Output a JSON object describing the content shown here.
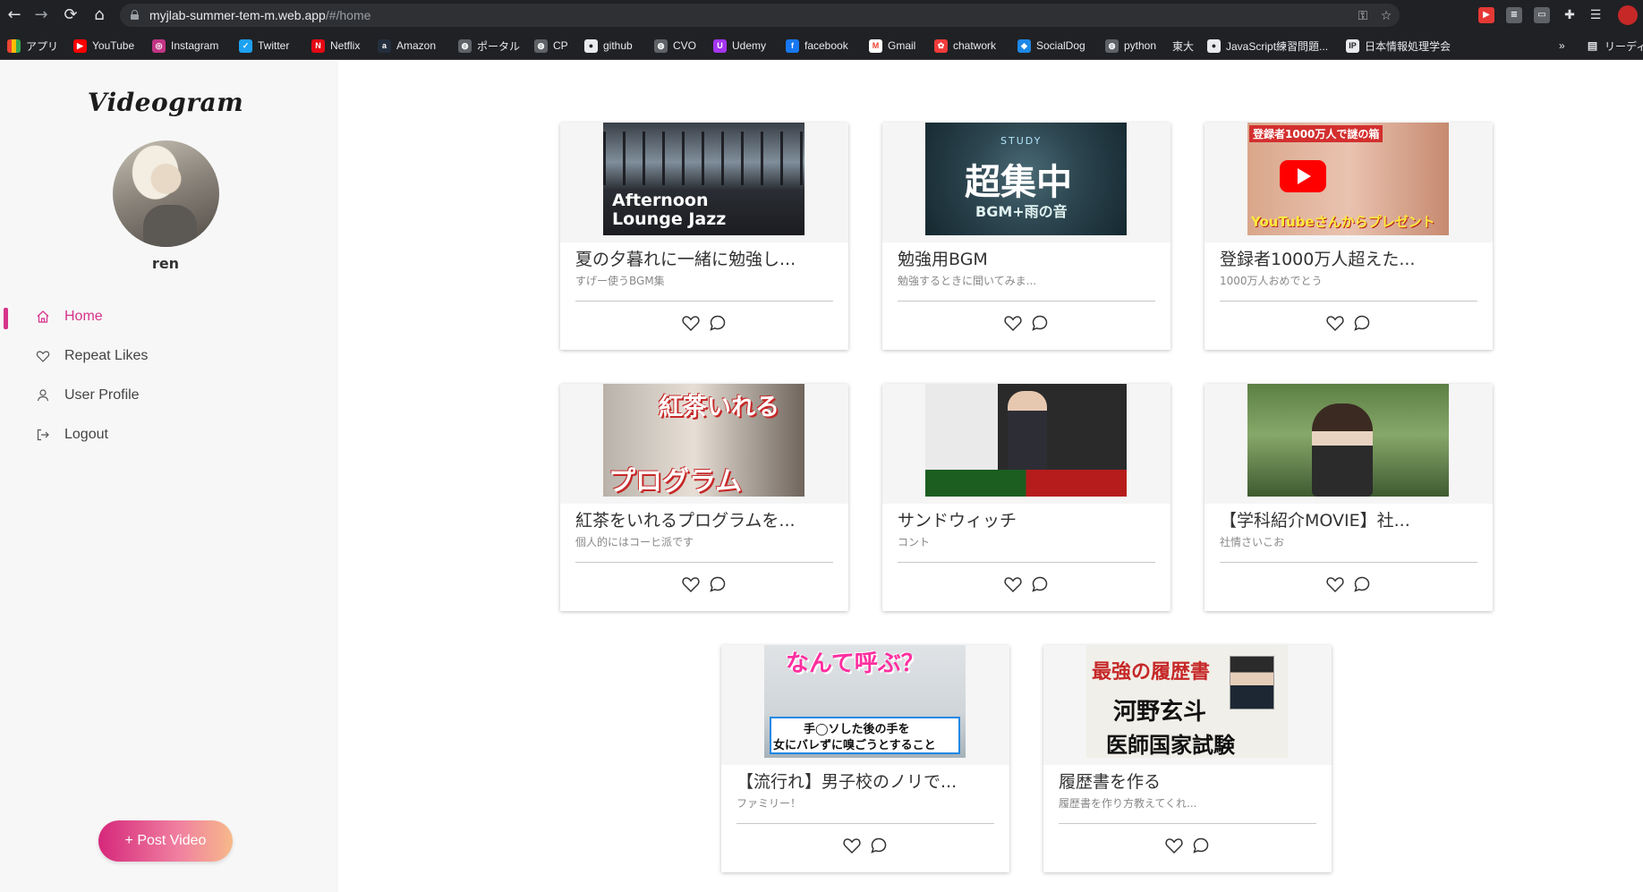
{
  "browser": {
    "url_host": "myjlab-summer-tem-m.web.app",
    "url_path": "/#/home",
    "bookmarks": [
      {
        "label": "アプリ",
        "icon": "apps-grid-icon",
        "color": "#ea4335"
      },
      {
        "label": "YouTube",
        "icon": "youtube-icon",
        "color": "#ff0000"
      },
      {
        "label": "Instagram",
        "icon": "instagram-icon",
        "color": "#c13584"
      },
      {
        "label": "Twitter",
        "icon": "twitter-icon",
        "color": "#1da1f2"
      },
      {
        "label": "Netflix",
        "icon": "netflix-icon",
        "color": "#e50914"
      },
      {
        "label": "Amazon",
        "icon": "amazon-icon",
        "color": "#232f3e"
      },
      {
        "label": "ポータル",
        "icon": "globe-icon",
        "color": "#9aa0a6"
      },
      {
        "label": "CP",
        "icon": "globe-icon",
        "color": "#9aa0a6"
      },
      {
        "label": "github",
        "icon": "github-icon",
        "color": "#e8eaed"
      },
      {
        "label": "CVO",
        "icon": "globe-icon",
        "color": "#9aa0a6"
      },
      {
        "label": "Udemy",
        "icon": "udemy-icon",
        "color": "#a435f0"
      },
      {
        "label": "facebook",
        "icon": "facebook-icon",
        "color": "#1877f2"
      },
      {
        "label": "Gmail",
        "icon": "gmail-icon",
        "color": "#ea4335"
      },
      {
        "label": "chatwork",
        "icon": "chatwork-icon",
        "color": "#f23b3b"
      },
      {
        "label": "SocialDog",
        "icon": "socialdog-icon",
        "color": "#1e88e5"
      },
      {
        "label": "python",
        "icon": "globe-icon",
        "color": "#9aa0a6"
      },
      {
        "label": "東大",
        "icon": "",
        "color": ""
      },
      {
        "label": "JavaScript練習問題...",
        "icon": "github-icon",
        "color": "#e8eaed"
      },
      {
        "label": "日本情報処理学会",
        "icon": "ipsj-icon",
        "color": "#e8eaed"
      }
    ],
    "more": "»",
    "reading_list": "リーディ"
  },
  "app": {
    "logo": "Videogram",
    "username": "ren",
    "accent_color": "#d6338a",
    "menu": [
      {
        "label": "Home",
        "icon": "home-icon",
        "active": true
      },
      {
        "label": "Repeat Likes",
        "icon": "heart-icon",
        "active": false
      },
      {
        "label": "User Profile",
        "icon": "user-icon",
        "active": false
      },
      {
        "label": "Logout",
        "icon": "logout-icon",
        "active": false
      }
    ],
    "post_button": "+ Post Video"
  },
  "videos": [
    {
      "title": "夏の夕暮れに一緒に勉強し...",
      "description": "すげー使うBGM集",
      "thumb_text": [
        "Afternoon",
        "Lounge Jazz"
      ]
    },
    {
      "title": "勉強用BGM",
      "description": "勉強するときに聞いてみま...",
      "thumb_text": [
        "STUDY",
        "超集中",
        "BGM+雨の音"
      ]
    },
    {
      "title": "登録者1000万人超えた...",
      "description": "1000万人おめでとう",
      "thumb_text": [
        "登録者1000万人で謎の箱",
        "YouTubeさんからプレゼント"
      ]
    },
    {
      "title": "紅茶をいれるプログラムを...",
      "description": "個人的にはコーヒ派です",
      "thumb_text": [
        "紅茶いれる",
        "プログラム"
      ]
    },
    {
      "title": "サンドウィッチ",
      "description": "コント",
      "thumb_text": []
    },
    {
      "title": "【学科紹介MOVIE】社...",
      "description": "社情さいこお",
      "thumb_text": []
    },
    {
      "title": "【流行れ】男子校のノリで...",
      "description": "ファミリー！",
      "thumb_text": [
        "なんて呼ぶ？",
        "手◯ソした後の手を",
        "女にバレずに嗅ごうとすること"
      ]
    },
    {
      "title": "履歴書を作る",
      "description": "履歴書を作り方教えてくれ...",
      "thumb_text": [
        "最強の履歴書",
        "河野玄斗",
        "医師国家試験"
      ]
    }
  ]
}
